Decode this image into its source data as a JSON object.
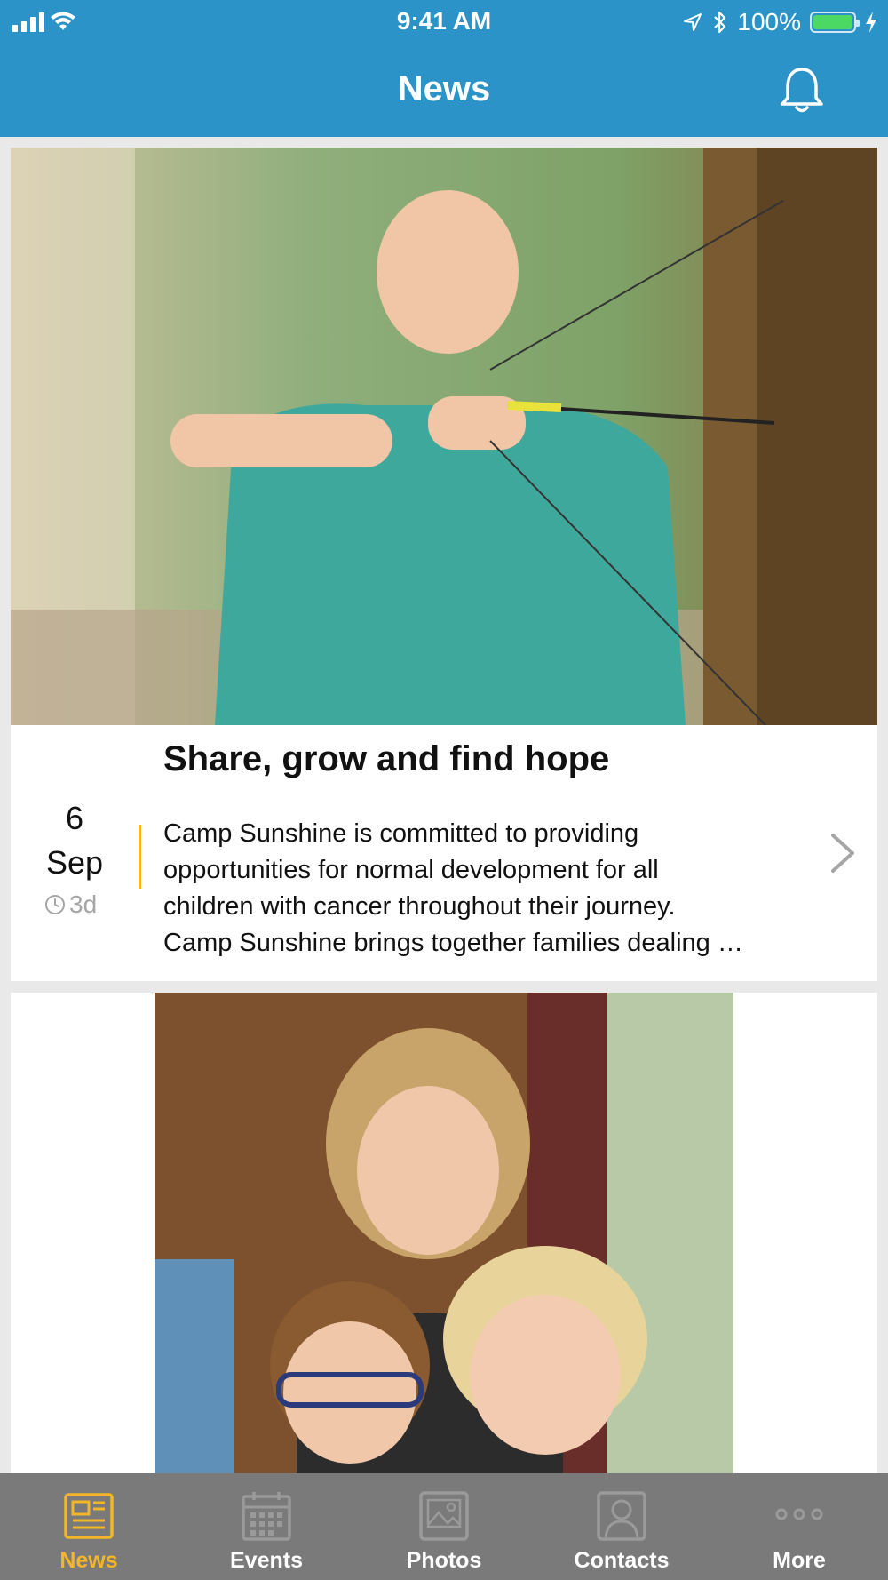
{
  "status_bar": {
    "time": "9:41 AM",
    "battery": "100%",
    "battery_level": 1.0
  },
  "header": {
    "title": "News",
    "notification_icon": "bell-icon"
  },
  "feed": [
    {
      "title": "Share, grow and find hope",
      "day": "6",
      "month": "Sep",
      "ago": "3d",
      "excerpt_lines": [
        "Camp Sunshine is committed to providing",
        "opportunities for normal development for all",
        "children with cancer throughout their journey.",
        "Camp Sunshine brings together families dealing …"
      ],
      "image": "photo: smiling child with archery bow"
    },
    {
      "image": "photo: woman with two smiling boys"
    }
  ],
  "tabs": [
    {
      "label": "News",
      "icon": "newspaper-icon",
      "active": true
    },
    {
      "label": "Events",
      "icon": "calendar-icon",
      "active": false
    },
    {
      "label": "Photos",
      "icon": "photo-icon",
      "active": false
    },
    {
      "label": "Contacts",
      "icon": "contact-icon",
      "active": false
    },
    {
      "label": "More",
      "icon": "more-icon",
      "active": false
    }
  ],
  "colors": {
    "header": "#2b93c7",
    "accent": "#f2b628",
    "tabbar": "#7a7a7a",
    "background": "#e9e9e9"
  }
}
